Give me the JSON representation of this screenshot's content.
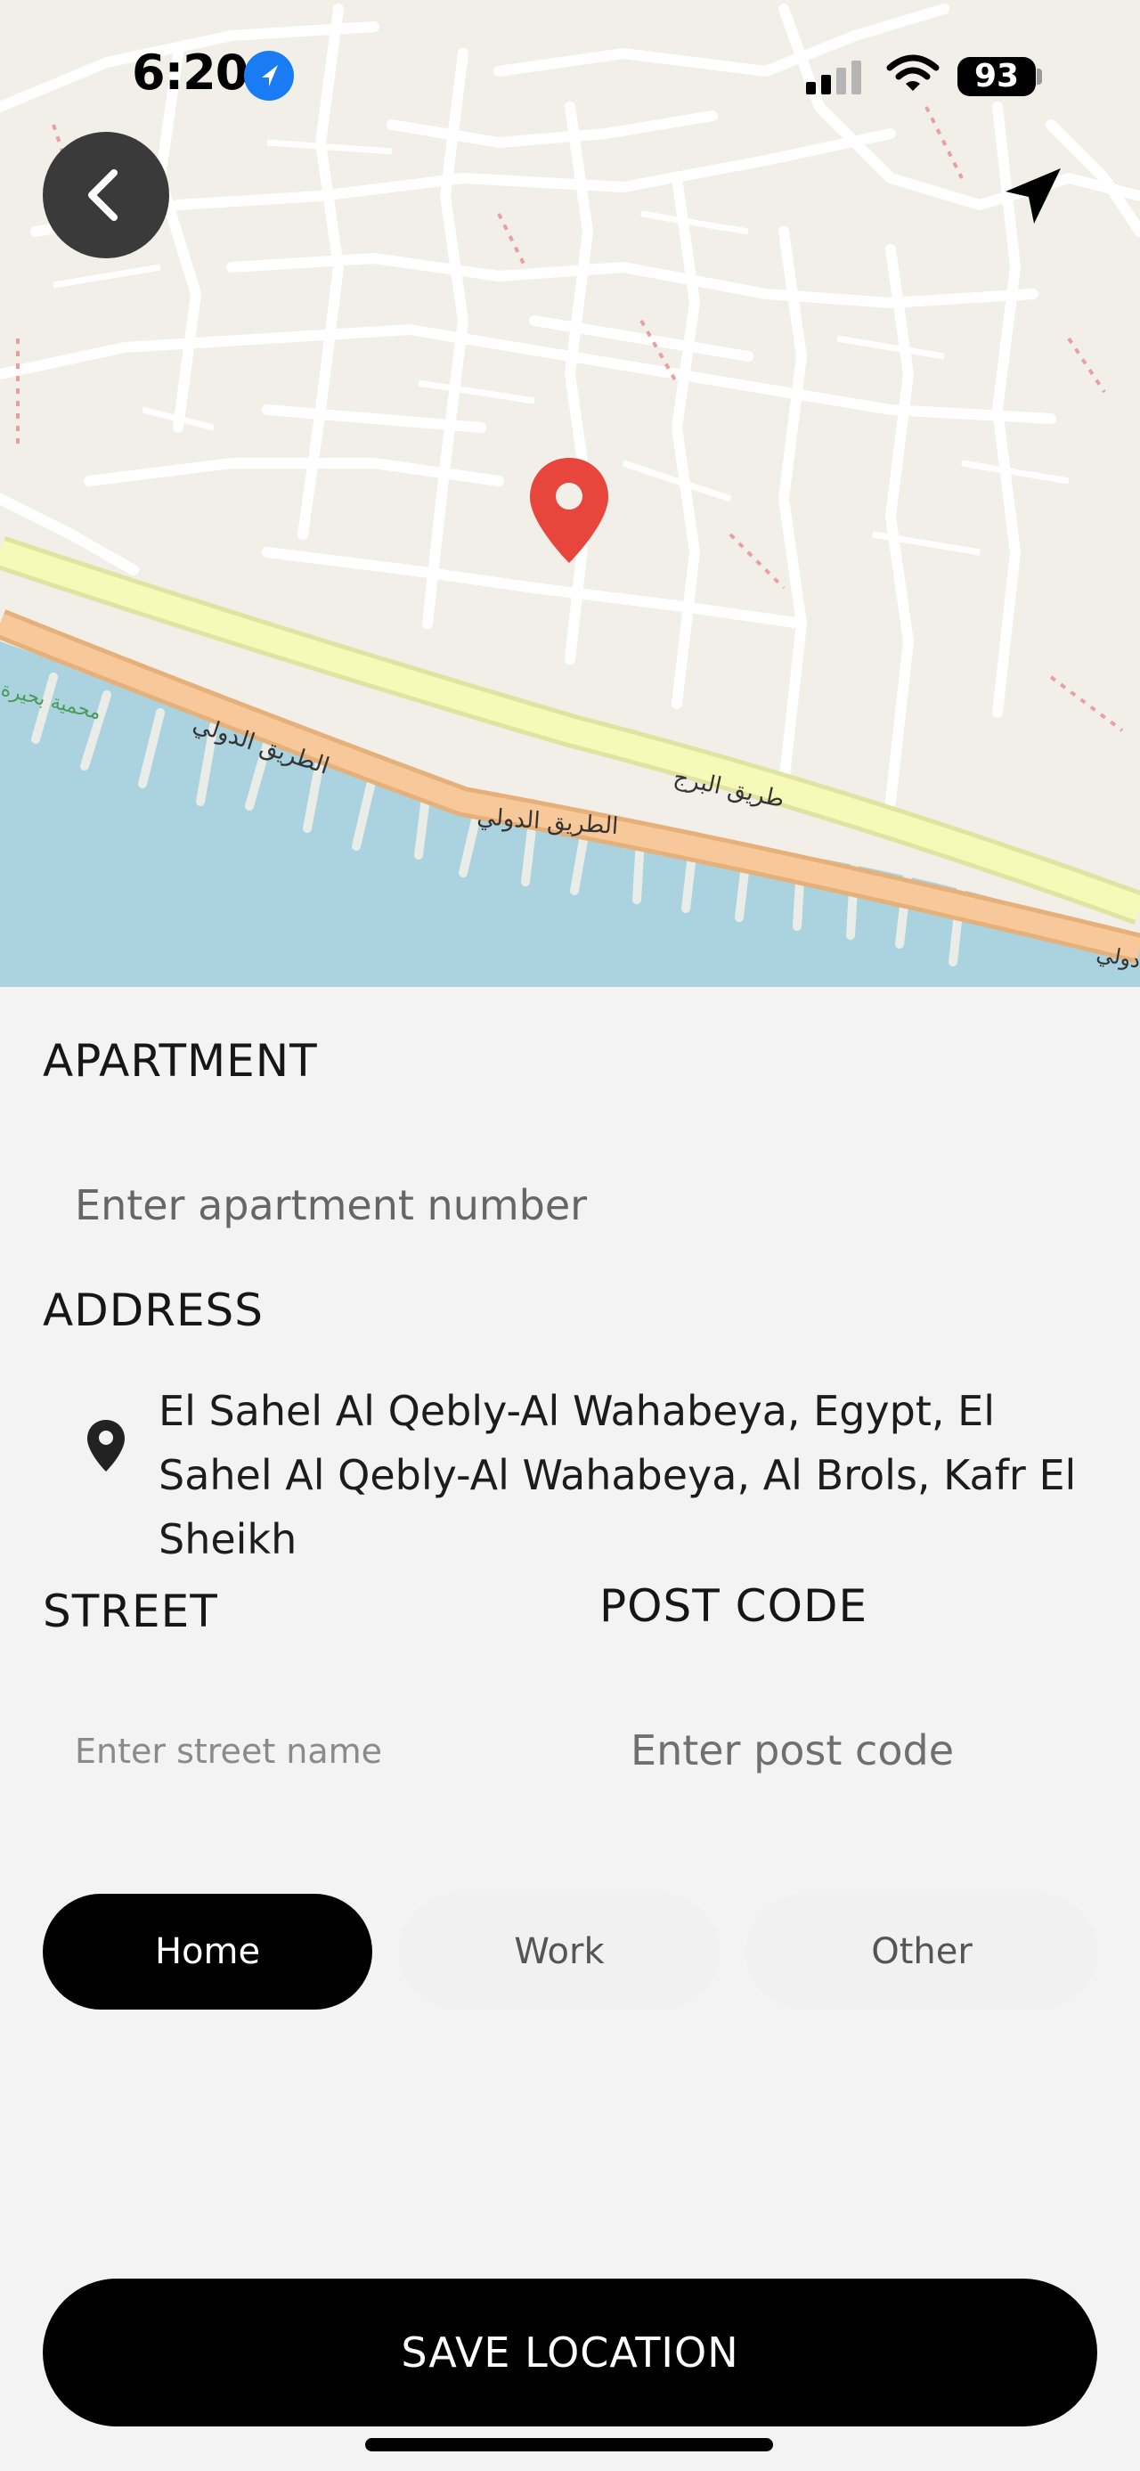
{
  "status_bar": {
    "time": "6:20",
    "battery": "93",
    "icons": [
      "location-arrow-icon",
      "cellular-signal-icon",
      "wifi-icon",
      "battery-icon"
    ]
  },
  "map": {
    "labels": [
      "محمية بحيرة",
      "الطريق الدولي",
      "طريق البرج",
      "الطريق الدولي",
      "دولي"
    ],
    "colors": {
      "land": "#f2efe9",
      "water": "#aad3df",
      "road_yellow": "#f7f9b8",
      "road_orange": "#f7c99a",
      "pin": "#e8453c"
    }
  },
  "form": {
    "apartment": {
      "label": "APARTMENT",
      "placeholder": "Enter apartment number"
    },
    "address": {
      "label": "ADDRESS",
      "value": "El Sahel Al Qebly-Al Wahabeya, Egypt, El Sahel Al Qebly-Al Wahabeya, Al Brols, Kafr El Sheikh"
    },
    "street": {
      "label": "STREET",
      "placeholder": "Enter street name"
    },
    "post_code": {
      "label": "POST CODE",
      "placeholder": "Enter post code"
    }
  },
  "address_type": {
    "options": [
      "Home",
      "Work",
      "Other"
    ],
    "selected": "Home"
  },
  "save_button": "SAVE LOCATION"
}
